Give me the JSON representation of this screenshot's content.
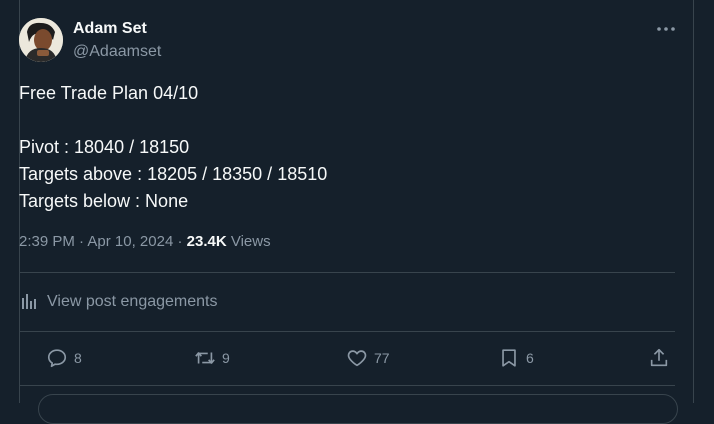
{
  "author": {
    "name": "Adam Set",
    "handle": "@Adaamset"
  },
  "post": {
    "lines": [
      "Free Trade Plan 04/10",
      "",
      "Pivot : 18040 / 18150",
      "Targets above : 18205 / 18350 / 18510",
      "Targets below : None"
    ],
    "time": "2:39 PM",
    "separator": "·",
    "date": "Apr 10, 2024",
    "views_count": "23.4K",
    "views_label": "Views"
  },
  "engagements_link": "View post engagements",
  "actions": {
    "replies": "8",
    "reposts": "9",
    "likes": "77",
    "bookmarks": "6"
  },
  "icons": {
    "more": "more-horizontal-icon",
    "engagements": "bar-chart-icon",
    "reply": "reply-icon",
    "repost": "repost-icon",
    "like": "heart-icon",
    "bookmark": "bookmark-icon",
    "share": "share-icon"
  },
  "colors": {
    "background": "#15202b",
    "text": "#f7f9f9",
    "secondary": "#8b98a5",
    "border": "#38444d"
  }
}
